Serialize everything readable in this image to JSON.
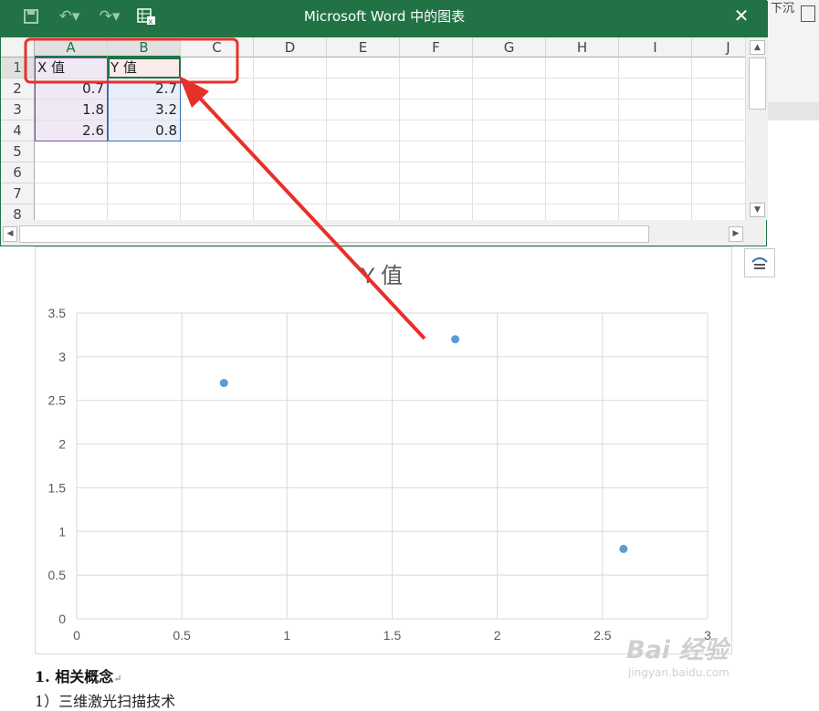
{
  "excel": {
    "title": "Microsoft Word 中的图表",
    "close_label": "✕",
    "columns": [
      "A",
      "B",
      "C",
      "D",
      "E",
      "F",
      "G",
      "H",
      "I",
      "J"
    ],
    "rows": [
      "1",
      "2",
      "3",
      "4",
      "5",
      "6",
      "7",
      "8"
    ],
    "cells": {
      "A1": "X 值",
      "B1": "Y 值",
      "A2": "0.7",
      "B2": "2.7",
      "A3": "1.8",
      "B3": "3.2",
      "A4": "2.6",
      "B4": "0.8"
    }
  },
  "word": {
    "ribbon_fragment": "下沉",
    "doc_heading": "1. 相关概念",
    "doc_para": "1）三维激光扫描技术"
  },
  "watermark": {
    "main": "Bai 经验",
    "sub": "jingyan.baidu.com"
  },
  "colors": {
    "excel_green": "#217346",
    "marker": "#5b9bd5",
    "arrow": "#e8302a"
  },
  "chart_data": {
    "type": "scatter",
    "title": "Y 值",
    "xlim": [
      0,
      3
    ],
    "ylim": [
      0,
      3.5
    ],
    "xticks": [
      "0",
      "0.5",
      "1",
      "1.5",
      "2",
      "2.5",
      "3"
    ],
    "yticks": [
      "0",
      "0.5",
      "1",
      "1.5",
      "2",
      "2.5",
      "3",
      "3.5"
    ],
    "grid": true,
    "series": [
      {
        "x": [
          0.7,
          1.8,
          2.6
        ],
        "y": [
          2.7,
          3.2,
          0.8
        ]
      }
    ]
  }
}
